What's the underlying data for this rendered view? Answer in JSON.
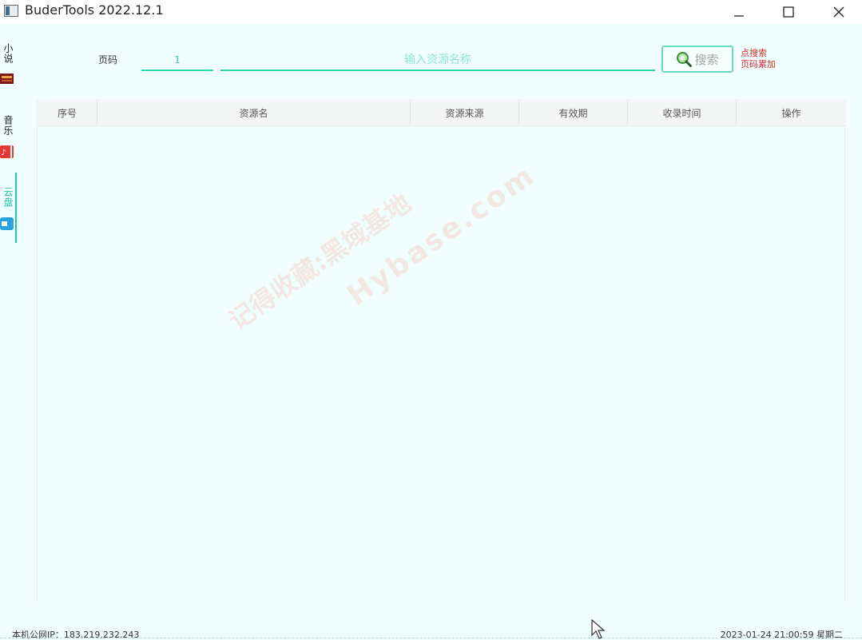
{
  "window": {
    "title": "BuderTools 2022.12.1"
  },
  "sidebar": {
    "tabs": [
      {
        "label": "小说",
        "icon": "book-icon",
        "color": "#c62828",
        "active": false
      },
      {
        "label": "音乐",
        "icon": "music-icon",
        "color": "#e53935",
        "active": false
      },
      {
        "label": "云盘",
        "icon": "cloud-drive-icon",
        "color": "#29a3d9",
        "active": true
      }
    ]
  },
  "search": {
    "page_label": "页码",
    "page_value": "1",
    "placeholder": "输入资源名称",
    "button_label": "搜索",
    "hint_line1": "点搜索",
    "hint_line2": "页码累加"
  },
  "table": {
    "columns": [
      "序号",
      "资源名",
      "资源来源",
      "有效期",
      "收录时间",
      "操作"
    ],
    "rows": []
  },
  "watermark": {
    "line1": "记得收藏:黑域基地",
    "line2": "Hybase.com"
  },
  "status": {
    "ip_text": "本机公网IP：183.219.232.243",
    "datetime": "2023-01-24 21:00:59 星期二"
  },
  "colors": {
    "accent": "#30d6b2",
    "background": "#f0fffe",
    "hint": "#d32f2f"
  }
}
